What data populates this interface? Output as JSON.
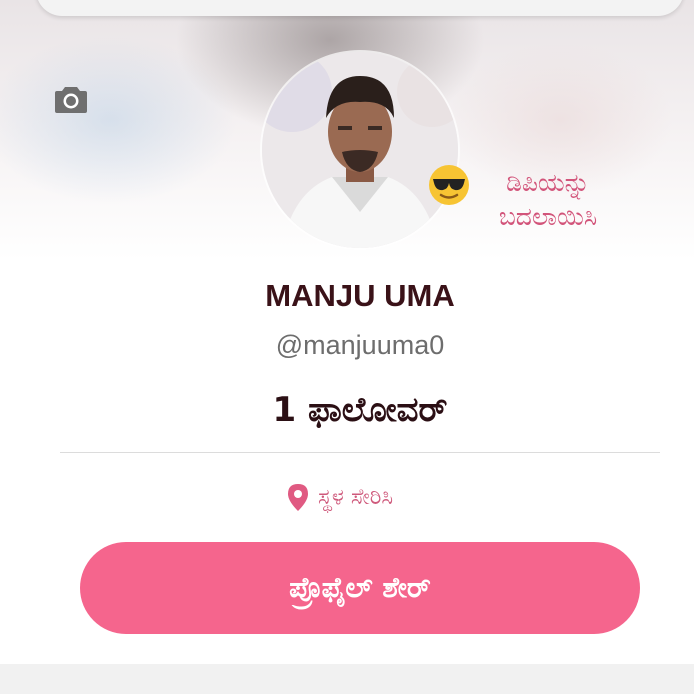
{
  "profile": {
    "name": "MANJU UMA",
    "handle": "@manjuuma0",
    "followers": "1 ಫಾಲೋವರ್",
    "change_dp": "ಡಿಪಿಯನ್ನು ಬದಲಾಯಿಸಿ",
    "location": "ಸ್ಥಳ ಸೇರಿಸಿ",
    "share_button": "ಪ್ರೊಫೈಲ್ ಶೇರ್"
  },
  "icons": {
    "cover_camera": "camera-icon",
    "dp_emoji": "sunglasses-emoji-icon",
    "location": "location-pin-icon"
  },
  "colors": {
    "accent": "#f5658d",
    "accent_text": "#d2547a",
    "name_text": "#3a1218"
  }
}
